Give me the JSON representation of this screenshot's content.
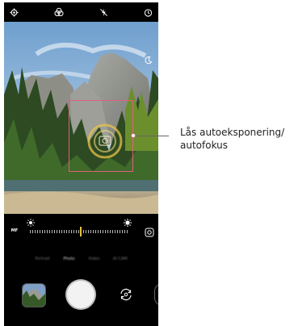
{
  "status_bar": {
    "icons": [
      "settings-icon",
      "filter-icon",
      "flash-off-icon",
      "timer-icon"
    ]
  },
  "viewfinder": {
    "scene": "mountain-cliff-forest-river",
    "focus_indicator_color": "#e0607e",
    "focus_ring_color": "#e8c24a",
    "night_mode_icon": "moon-icon"
  },
  "controls": {
    "mf_label": "MF",
    "exposure_slider": {
      "min_icon": "sun-dim-icon",
      "max_icon": "sun-bright-icon",
      "level": 0.52,
      "thumb_color": "#e6c13c"
    },
    "lens_switch_icon": "lens-swap-icon",
    "modes": [
      {
        "label": "Portrait",
        "active": false
      },
      {
        "label": "Photo",
        "active": true
      },
      {
        "label": "Video",
        "active": false
      },
      {
        "label": "AI CAM",
        "active": false
      }
    ],
    "gallery_icon": "gallery-thumbnail",
    "shutter_icon": "shutter-button",
    "switch_camera_icon": "switch-camera-icon"
  },
  "callout": {
    "line1": "Lås autoeksponering/",
    "line2": "autofokus",
    "color": "#e0607e"
  }
}
